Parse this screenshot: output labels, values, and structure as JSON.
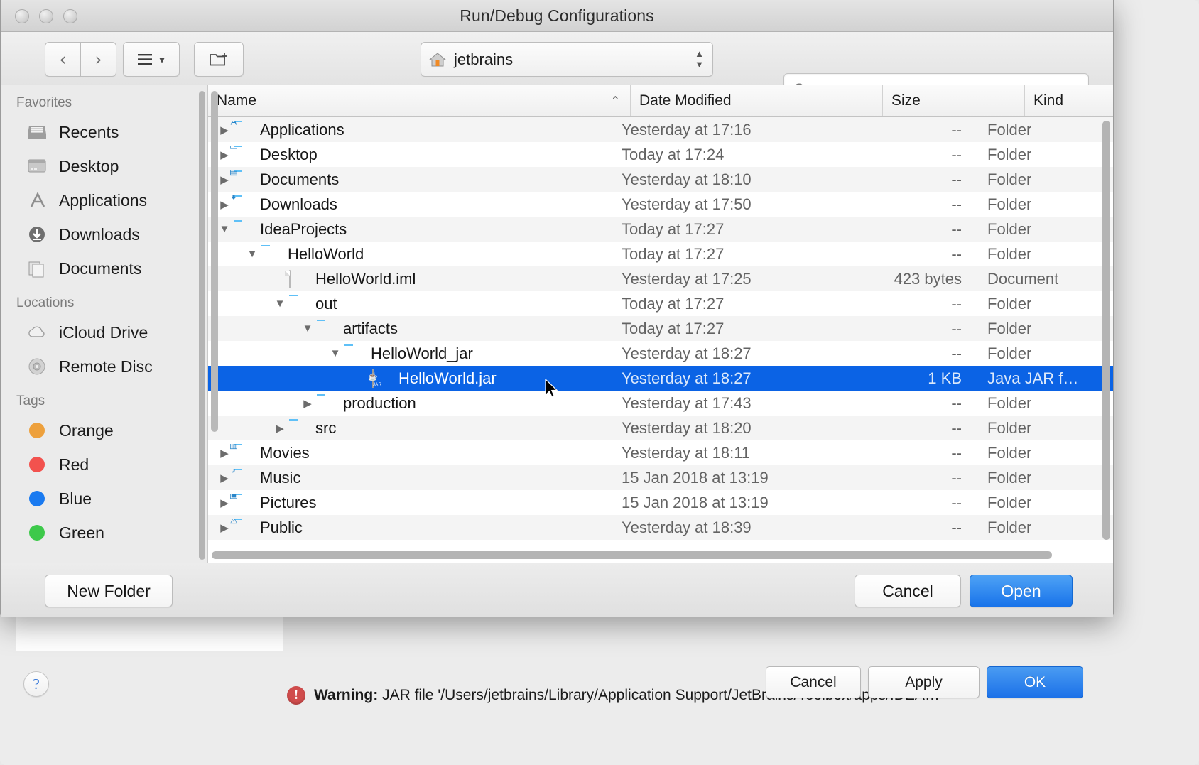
{
  "idea_dialog": {
    "warning": {
      "icon": "warning-icon",
      "label": "Warning:",
      "message": "JAR file '/Users/jetbrains/Library/Application Support/JetBrains/Toolbox/apps/IDEA…"
    },
    "help_button": "?",
    "buttons": [
      {
        "id": "idea-cancel",
        "label": "Cancel",
        "primary": false
      },
      {
        "id": "idea-apply",
        "label": "Apply",
        "primary": false
      },
      {
        "id": "idea-ok",
        "label": "OK",
        "primary": true
      }
    ]
  },
  "sheet": {
    "title": "Run/Debug Configurations",
    "toolbar": {
      "back_icon": "chevron-left-icon",
      "forward_icon": "chevron-right-icon",
      "view_icon": "list-view-icon",
      "view_chevron": "chevron-down-icon",
      "new_folder_icon": "new-folder-icon",
      "path_label": "jetbrains",
      "path_icon": "home-icon",
      "stepper_icon": "up-down-stepper-icon",
      "search_icon": "search-icon",
      "search_value": "",
      "search_placeholder": ""
    },
    "sidebar": {
      "sections": [
        {
          "title": "Favorites",
          "items": [
            {
              "label": "Recents",
              "icon": "recents-icon"
            },
            {
              "label": "Desktop",
              "icon": "desktop-icon"
            },
            {
              "label": "Applications",
              "icon": "applications-icon"
            },
            {
              "label": "Downloads",
              "icon": "downloads-icon"
            },
            {
              "label": "Documents",
              "icon": "documents-icon"
            }
          ]
        },
        {
          "title": "Locations",
          "items": [
            {
              "label": "iCloud Drive",
              "icon": "icloud-icon"
            },
            {
              "label": "Remote Disc",
              "icon": "disc-icon"
            }
          ]
        },
        {
          "title": "Tags",
          "items": [
            {
              "label": "Orange",
              "icon": "tag-dot-icon",
              "color": "#eda03c"
            },
            {
              "label": "Red",
              "icon": "tag-dot-icon",
              "color": "#f2524e"
            },
            {
              "label": "Blue",
              "icon": "tag-dot-icon",
              "color": "#1a7af0"
            },
            {
              "label": "Green",
              "icon": "tag-dot-icon",
              "color": "#3dc94a"
            }
          ]
        }
      ]
    },
    "columns": {
      "name": "Name",
      "date": "Date Modified",
      "size": "Size",
      "kind": "Kind",
      "sort_caret": "caret-up-icon"
    },
    "rows": [
      {
        "name": "Applications",
        "date": "Yesterday at 17:16",
        "size": "--",
        "kind": "Folder",
        "depth": 0,
        "twisty": "collapsed",
        "icon": "folder-applications-icon",
        "selected": false
      },
      {
        "name": "Desktop",
        "date": "Today at 17:24",
        "size": "--",
        "kind": "Folder",
        "depth": 0,
        "twisty": "collapsed",
        "icon": "folder-desktop-icon",
        "selected": false
      },
      {
        "name": "Documents",
        "date": "Yesterday at 18:10",
        "size": "--",
        "kind": "Folder",
        "depth": 0,
        "twisty": "collapsed",
        "icon": "folder-documents-icon",
        "selected": false
      },
      {
        "name": "Downloads",
        "date": "Yesterday at 17:50",
        "size": "--",
        "kind": "Folder",
        "depth": 0,
        "twisty": "collapsed",
        "icon": "folder-downloads-icon",
        "selected": false
      },
      {
        "name": "IdeaProjects",
        "date": "Today at 17:27",
        "size": "--",
        "kind": "Folder",
        "depth": 0,
        "twisty": "expanded",
        "icon": "folder-icon",
        "selected": false
      },
      {
        "name": "HelloWorld",
        "date": "Today at 17:27",
        "size": "--",
        "kind": "Folder",
        "depth": 1,
        "twisty": "expanded",
        "icon": "folder-icon",
        "selected": false
      },
      {
        "name": "HelloWorld.iml",
        "date": "Yesterday at 17:25",
        "size": "423 bytes",
        "kind": "Document",
        "depth": 2,
        "twisty": "none",
        "icon": "document-icon",
        "selected": false
      },
      {
        "name": "out",
        "date": "Today at 17:27",
        "size": "--",
        "kind": "Folder",
        "depth": 2,
        "twisty": "expanded",
        "icon": "folder-icon",
        "selected": false
      },
      {
        "name": "artifacts",
        "date": "Today at 17:27",
        "size": "--",
        "kind": "Folder",
        "depth": 3,
        "twisty": "expanded",
        "icon": "folder-icon",
        "selected": false
      },
      {
        "name": "HelloWorld_jar",
        "date": "Yesterday at 18:27",
        "size": "--",
        "kind": "Folder",
        "depth": 4,
        "twisty": "expanded",
        "icon": "folder-icon",
        "selected": false
      },
      {
        "name": "HelloWorld.jar",
        "date": "Yesterday at 18:27",
        "size": "1 KB",
        "kind": "Java JAR f…",
        "depth": 5,
        "twisty": "none",
        "icon": "jar-icon",
        "selected": true
      },
      {
        "name": "production",
        "date": "Yesterday at 17:43",
        "size": "--",
        "kind": "Folder",
        "depth": 3,
        "twisty": "collapsed",
        "icon": "folder-icon",
        "selected": false
      },
      {
        "name": "src",
        "date": "Yesterday at 18:20",
        "size": "--",
        "kind": "Folder",
        "depth": 2,
        "twisty": "collapsed",
        "icon": "folder-icon",
        "selected": false
      },
      {
        "name": "Movies",
        "date": "Yesterday at 18:11",
        "size": "--",
        "kind": "Folder",
        "depth": 0,
        "twisty": "collapsed",
        "icon": "folder-movies-icon",
        "selected": false
      },
      {
        "name": "Music",
        "date": "15 Jan 2018 at 13:19",
        "size": "--",
        "kind": "Folder",
        "depth": 0,
        "twisty": "collapsed",
        "icon": "folder-music-icon",
        "selected": false
      },
      {
        "name": "Pictures",
        "date": "15 Jan 2018 at 13:19",
        "size": "--",
        "kind": "Folder",
        "depth": 0,
        "twisty": "collapsed",
        "icon": "folder-pictures-icon",
        "selected": false
      },
      {
        "name": "Public",
        "date": "Yesterday at 18:39",
        "size": "--",
        "kind": "Folder",
        "depth": 0,
        "twisty": "collapsed",
        "icon": "folder-public-icon",
        "selected": false
      }
    ],
    "footer": {
      "new_folder": "New Folder",
      "cancel": "Cancel",
      "open": "Open"
    }
  },
  "colors": {
    "selection_blue": "#0b63e5",
    "primary_button": "#1873ea",
    "folder_blue": "#5fc0f7",
    "warning_red": "#d04c4c"
  }
}
